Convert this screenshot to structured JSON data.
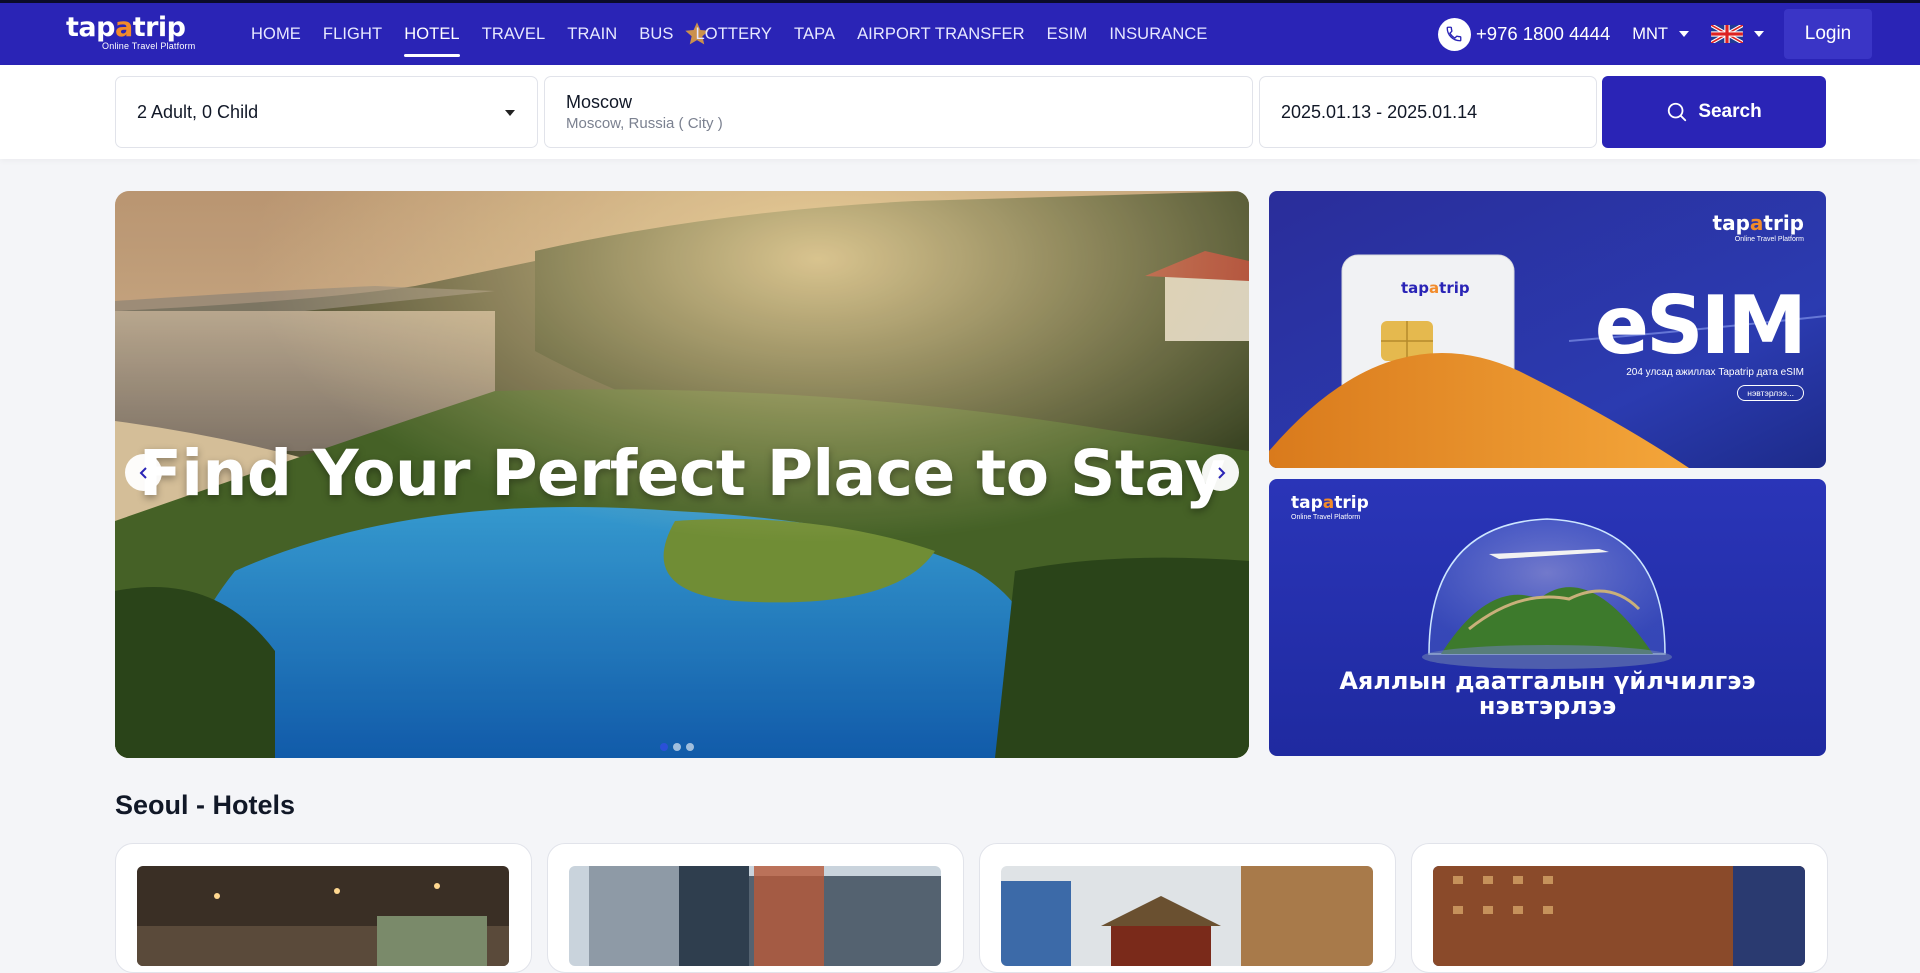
{
  "header": {
    "logo": {
      "part1": "tap",
      "accent": "a",
      "part2": "trip",
      "tagline": "Online Travel Platform"
    },
    "nav": [
      {
        "label": "HOME",
        "active": false
      },
      {
        "label": "FLIGHT",
        "active": false
      },
      {
        "label": "HOTEL",
        "active": true
      },
      {
        "label": "TRAVEL",
        "active": false
      },
      {
        "label": "TRAIN",
        "active": false
      },
      {
        "label": "BUS",
        "active": false
      },
      {
        "label": "LOTTERY",
        "active": false
      },
      {
        "label": "TAPA",
        "active": false
      },
      {
        "label": "AIRPORT TRANSFER",
        "active": false
      },
      {
        "label": "ESIM",
        "active": false
      },
      {
        "label": "INSURANCE",
        "active": false
      }
    ],
    "phone": "+976 1800 4444",
    "currency": "MNT",
    "login_label": "Login"
  },
  "search": {
    "guests": "2 Adult, 0 Child",
    "destination": "Moscow",
    "destination_sub": "Moscow, Russia ( City )",
    "dates": "2025.01.13 - 2025.01.14",
    "button_label": "Search"
  },
  "hero": {
    "title": "Find Your Perfect Place to Stay",
    "slide_count": 3,
    "active_slide": 0
  },
  "banners": {
    "esim": {
      "logo": {
        "part1": "tap",
        "accent": "a",
        "part2": "trip",
        "tagline": "Online Travel Platform"
      },
      "card_logo": {
        "part1": "tap",
        "accent": "a",
        "part2": "trip"
      },
      "headline": "eSIM",
      "description": "204 улсад ажиллах Tapatrip дата eSIM",
      "cta": "нэвтэрлээ..."
    },
    "insurance": {
      "logo": {
        "part1": "tap",
        "accent": "a",
        "part2": "trip",
        "tagline": "Online Travel Platform"
      },
      "line1": "Аяллын даатгалын үйлчилгээ",
      "line2": "нэвтэрлээ"
    }
  },
  "section": {
    "title": "Seoul - Hotels"
  },
  "colors": {
    "brand": "#2a24b6",
    "accent": "#f28b2a",
    "background": "#f4f5f8"
  }
}
